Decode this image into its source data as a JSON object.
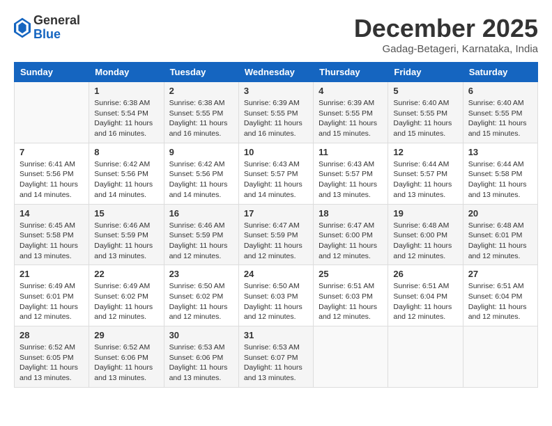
{
  "header": {
    "logo_line1": "General",
    "logo_line2": "Blue",
    "month": "December 2025",
    "location": "Gadag-Betageri, Karnataka, India"
  },
  "weekdays": [
    "Sunday",
    "Monday",
    "Tuesday",
    "Wednesday",
    "Thursday",
    "Friday",
    "Saturday"
  ],
  "weeks": [
    [
      {
        "day": "",
        "sunrise": "",
        "sunset": "",
        "daylight": ""
      },
      {
        "day": "1",
        "sunrise": "Sunrise: 6:38 AM",
        "sunset": "Sunset: 5:54 PM",
        "daylight": "Daylight: 11 hours and 16 minutes."
      },
      {
        "day": "2",
        "sunrise": "Sunrise: 6:38 AM",
        "sunset": "Sunset: 5:55 PM",
        "daylight": "Daylight: 11 hours and 16 minutes."
      },
      {
        "day": "3",
        "sunrise": "Sunrise: 6:39 AM",
        "sunset": "Sunset: 5:55 PM",
        "daylight": "Daylight: 11 hours and 16 minutes."
      },
      {
        "day": "4",
        "sunrise": "Sunrise: 6:39 AM",
        "sunset": "Sunset: 5:55 PM",
        "daylight": "Daylight: 11 hours and 15 minutes."
      },
      {
        "day": "5",
        "sunrise": "Sunrise: 6:40 AM",
        "sunset": "Sunset: 5:55 PM",
        "daylight": "Daylight: 11 hours and 15 minutes."
      },
      {
        "day": "6",
        "sunrise": "Sunrise: 6:40 AM",
        "sunset": "Sunset: 5:55 PM",
        "daylight": "Daylight: 11 hours and 15 minutes."
      }
    ],
    [
      {
        "day": "7",
        "sunrise": "Sunrise: 6:41 AM",
        "sunset": "Sunset: 5:56 PM",
        "daylight": "Daylight: 11 hours and 14 minutes."
      },
      {
        "day": "8",
        "sunrise": "Sunrise: 6:42 AM",
        "sunset": "Sunset: 5:56 PM",
        "daylight": "Daylight: 11 hours and 14 minutes."
      },
      {
        "day": "9",
        "sunrise": "Sunrise: 6:42 AM",
        "sunset": "Sunset: 5:56 PM",
        "daylight": "Daylight: 11 hours and 14 minutes."
      },
      {
        "day": "10",
        "sunrise": "Sunrise: 6:43 AM",
        "sunset": "Sunset: 5:57 PM",
        "daylight": "Daylight: 11 hours and 14 minutes."
      },
      {
        "day": "11",
        "sunrise": "Sunrise: 6:43 AM",
        "sunset": "Sunset: 5:57 PM",
        "daylight": "Daylight: 11 hours and 13 minutes."
      },
      {
        "day": "12",
        "sunrise": "Sunrise: 6:44 AM",
        "sunset": "Sunset: 5:57 PM",
        "daylight": "Daylight: 11 hours and 13 minutes."
      },
      {
        "day": "13",
        "sunrise": "Sunrise: 6:44 AM",
        "sunset": "Sunset: 5:58 PM",
        "daylight": "Daylight: 11 hours and 13 minutes."
      }
    ],
    [
      {
        "day": "14",
        "sunrise": "Sunrise: 6:45 AM",
        "sunset": "Sunset: 5:58 PM",
        "daylight": "Daylight: 11 hours and 13 minutes."
      },
      {
        "day": "15",
        "sunrise": "Sunrise: 6:46 AM",
        "sunset": "Sunset: 5:59 PM",
        "daylight": "Daylight: 11 hours and 13 minutes."
      },
      {
        "day": "16",
        "sunrise": "Sunrise: 6:46 AM",
        "sunset": "Sunset: 5:59 PM",
        "daylight": "Daylight: 11 hours and 12 minutes."
      },
      {
        "day": "17",
        "sunrise": "Sunrise: 6:47 AM",
        "sunset": "Sunset: 5:59 PM",
        "daylight": "Daylight: 11 hours and 12 minutes."
      },
      {
        "day": "18",
        "sunrise": "Sunrise: 6:47 AM",
        "sunset": "Sunset: 6:00 PM",
        "daylight": "Daylight: 11 hours and 12 minutes."
      },
      {
        "day": "19",
        "sunrise": "Sunrise: 6:48 AM",
        "sunset": "Sunset: 6:00 PM",
        "daylight": "Daylight: 11 hours and 12 minutes."
      },
      {
        "day": "20",
        "sunrise": "Sunrise: 6:48 AM",
        "sunset": "Sunset: 6:01 PM",
        "daylight": "Daylight: 11 hours and 12 minutes."
      }
    ],
    [
      {
        "day": "21",
        "sunrise": "Sunrise: 6:49 AM",
        "sunset": "Sunset: 6:01 PM",
        "daylight": "Daylight: 11 hours and 12 minutes."
      },
      {
        "day": "22",
        "sunrise": "Sunrise: 6:49 AM",
        "sunset": "Sunset: 6:02 PM",
        "daylight": "Daylight: 11 hours and 12 minutes."
      },
      {
        "day": "23",
        "sunrise": "Sunrise: 6:50 AM",
        "sunset": "Sunset: 6:02 PM",
        "daylight": "Daylight: 11 hours and 12 minutes."
      },
      {
        "day": "24",
        "sunrise": "Sunrise: 6:50 AM",
        "sunset": "Sunset: 6:03 PM",
        "daylight": "Daylight: 11 hours and 12 minutes."
      },
      {
        "day": "25",
        "sunrise": "Sunrise: 6:51 AM",
        "sunset": "Sunset: 6:03 PM",
        "daylight": "Daylight: 11 hours and 12 minutes."
      },
      {
        "day": "26",
        "sunrise": "Sunrise: 6:51 AM",
        "sunset": "Sunset: 6:04 PM",
        "daylight": "Daylight: 11 hours and 12 minutes."
      },
      {
        "day": "27",
        "sunrise": "Sunrise: 6:51 AM",
        "sunset": "Sunset: 6:04 PM",
        "daylight": "Daylight: 11 hours and 12 minutes."
      }
    ],
    [
      {
        "day": "28",
        "sunrise": "Sunrise: 6:52 AM",
        "sunset": "Sunset: 6:05 PM",
        "daylight": "Daylight: 11 hours and 13 minutes."
      },
      {
        "day": "29",
        "sunrise": "Sunrise: 6:52 AM",
        "sunset": "Sunset: 6:06 PM",
        "daylight": "Daylight: 11 hours and 13 minutes."
      },
      {
        "day": "30",
        "sunrise": "Sunrise: 6:53 AM",
        "sunset": "Sunset: 6:06 PM",
        "daylight": "Daylight: 11 hours and 13 minutes."
      },
      {
        "day": "31",
        "sunrise": "Sunrise: 6:53 AM",
        "sunset": "Sunset: 6:07 PM",
        "daylight": "Daylight: 11 hours and 13 minutes."
      },
      {
        "day": "",
        "sunrise": "",
        "sunset": "",
        "daylight": ""
      },
      {
        "day": "",
        "sunrise": "",
        "sunset": "",
        "daylight": ""
      },
      {
        "day": "",
        "sunrise": "",
        "sunset": "",
        "daylight": ""
      }
    ]
  ]
}
